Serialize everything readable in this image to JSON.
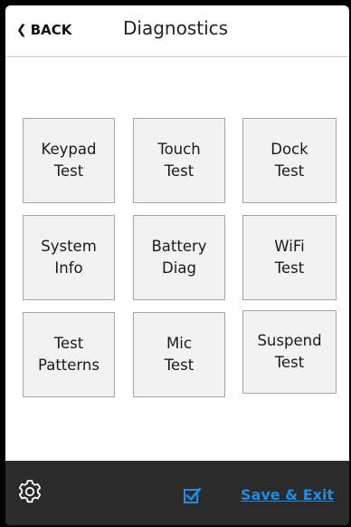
{
  "header": {
    "back_label": "BACK",
    "title": "Diagnostics"
  },
  "tiles": [
    {
      "line1": "Keypad",
      "line2": "Test"
    },
    {
      "line1": "Touch",
      "line2": "Test"
    },
    {
      "line1": "Dock",
      "line2": "Test"
    },
    {
      "line1": "System",
      "line2": "Info"
    },
    {
      "line1": "Battery",
      "line2": "Diag"
    },
    {
      "line1": "WiFi",
      "line2": "Test"
    },
    {
      "line1": "Test",
      "line2": "Patterns"
    },
    {
      "line1": "Mic",
      "line2": "Test"
    },
    {
      "line1": "Suspend",
      "line2": "Test"
    }
  ],
  "footer": {
    "save_label": "Save & Exit",
    "settings_icon": "gear-icon",
    "checkbox_checked": true
  },
  "colors": {
    "accent": "#1f8ce8",
    "footer_bg": "#2b2b2b",
    "tile_bg": "#f2f2f2",
    "tile_border": "#a6a6a6"
  }
}
